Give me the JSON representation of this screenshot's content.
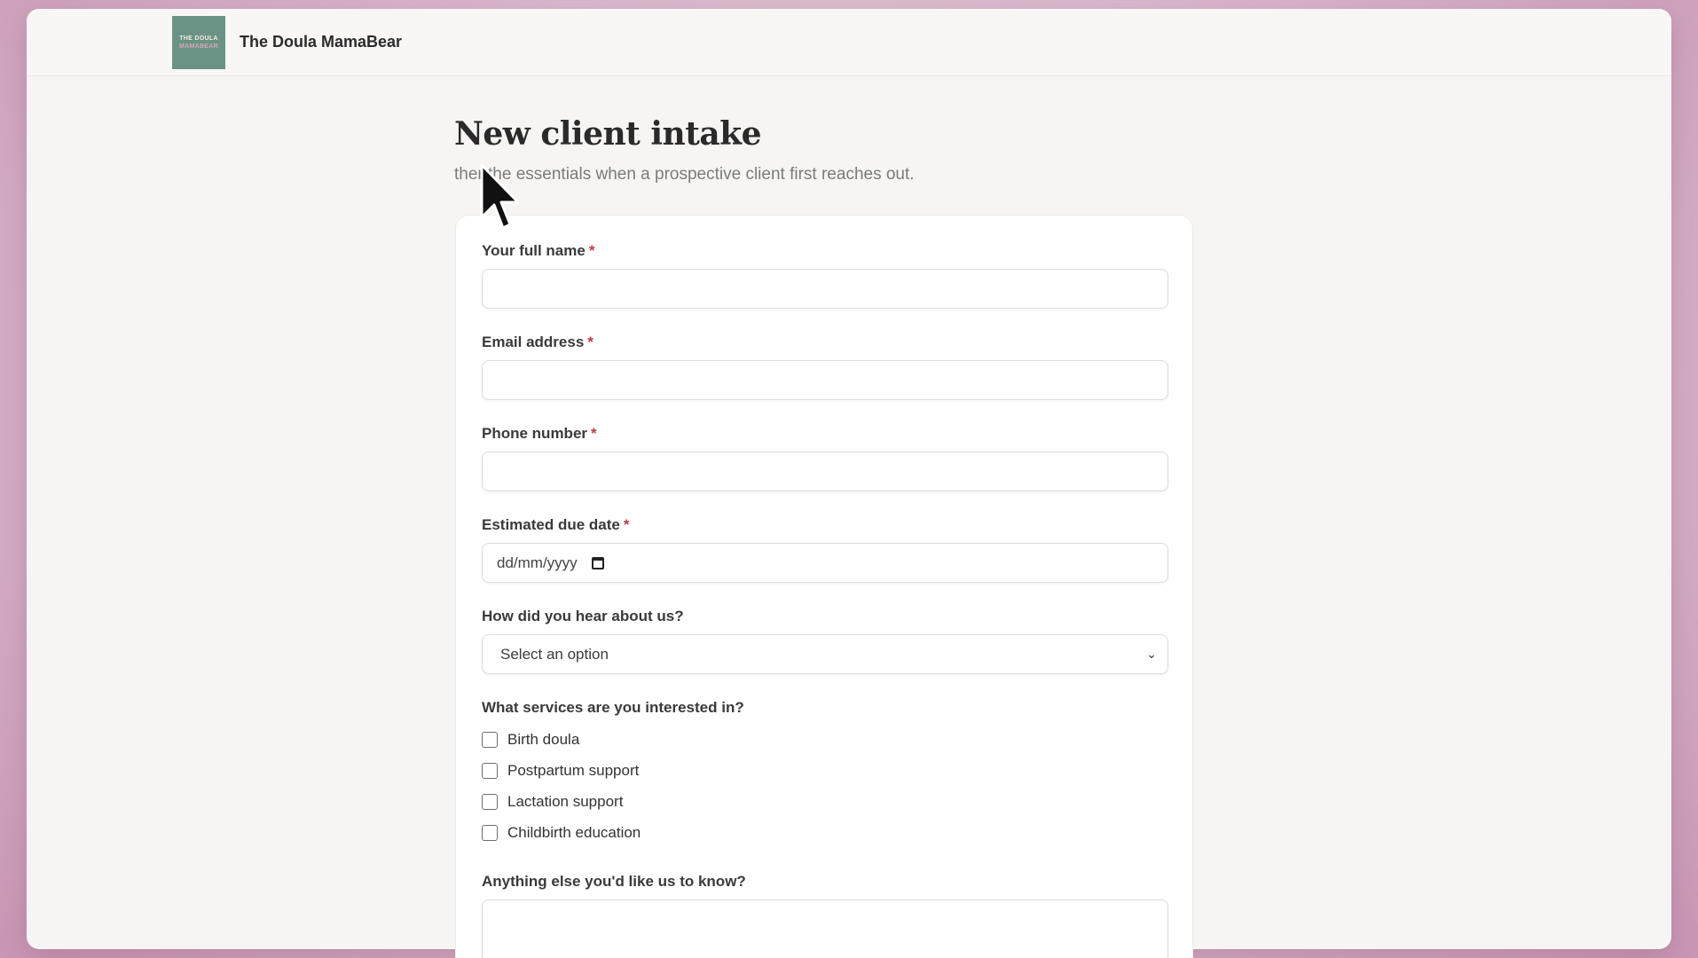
{
  "header": {
    "logo_line1": "THE DOULA",
    "logo_line2": "MAMABEAR",
    "brand": "The Doula MamaBear"
  },
  "page": {
    "title": "New client intake",
    "subtitle": "ther the essentials when a prospective client first reaches out."
  },
  "form": {
    "required_mark": "*",
    "full_name": {
      "label": "Your full name",
      "value": ""
    },
    "email": {
      "label": "Email address",
      "value": ""
    },
    "phone": {
      "label": "Phone number",
      "value": ""
    },
    "due_date": {
      "label": "Estimated due date",
      "value": "dd/mm/yyyy"
    },
    "hear_about": {
      "label": "How did you hear about us?",
      "selected": "Select an option"
    },
    "services": {
      "label": "What services are you interested in?",
      "options": [
        "Birth doula",
        "Postpartum support",
        "Lactation support",
        "Childbirth education"
      ]
    },
    "notes": {
      "label": "Anything else you'd like us to know?",
      "value": ""
    }
  },
  "colors": {
    "accent_required": "#c23a4a",
    "logo_bg": "#6a9386"
  },
  "icons": {
    "calendar": "calendar-icon",
    "chevron": "chevron-down-icon",
    "cursor": "mouse-cursor-icon"
  }
}
